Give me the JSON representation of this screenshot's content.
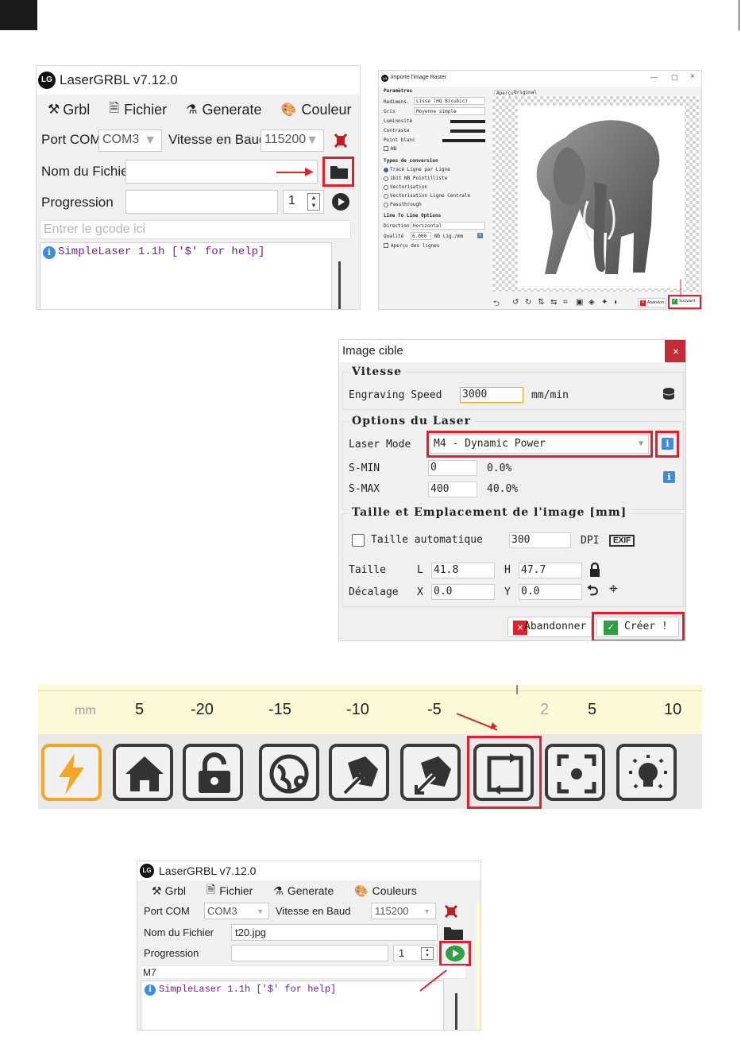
{
  "app": {
    "title": "LaserGRBL v7.12.0",
    "logo_text": "LG"
  },
  "menu": {
    "grbl": "Grbl",
    "fichier": "Fichier",
    "generate": "Generate",
    "couleurs_cut": "Couleur",
    "couleurs": "Couleurs"
  },
  "main1": {
    "port_label": "Port COM",
    "port_value": "COM3",
    "baud_label": "Vitesse en Baud",
    "baud_value": "115200",
    "file_label": "Nom du Fichier",
    "file_value": "",
    "progress_label": "Progression",
    "repeat_value": "1",
    "gcode_placeholder": "Entrer le gcode ici",
    "console_line": "SimpleLaser 1.1h ['$' for help]"
  },
  "raster": {
    "title": "Importe l'image Raster",
    "group_params": "Paramètres",
    "redim_label": "Redimens.",
    "redim_value": "Lisse (HQ Bicubic)",
    "gris_label": "Gris",
    "gris_value": "Moyenne simple",
    "lum_label": "Luminosité",
    "contrast_label": "Contraste",
    "white_label": "Point blanc",
    "nb_label": "NB",
    "group_conv": "Types de conversion",
    "conv_options": [
      "Tracé Ligne par Ligne",
      "1bit NB Pointilliste",
      "Vectorisation",
      "Vectorisation Ligne Centrale",
      "Passthrough"
    ],
    "group_line": "Line To Line Options",
    "direction_label": "Direction",
    "direction_value": "Horizontal",
    "quality_label": "Qualité",
    "quality_value": "6.000",
    "quality_unit": "Nb Lig./mm",
    "preview_lines_label": "Aperçu des lignes",
    "tab_preview": "Aperçu",
    "tab_original": "Original",
    "btn_cancel": "Abandon.",
    "btn_next": "Suivant"
  },
  "cible": {
    "title": "Image cible",
    "close": "×",
    "group_speed": "Vitesse",
    "speed_label": "Engraving Speed",
    "speed_value": "3000",
    "speed_unit": "mm/min",
    "group_laser": "Options du Laser",
    "mode_label": "Laser Mode",
    "mode_value": "M4 - Dynamic Power",
    "smin_label": "S-MIN",
    "smin_value": "0",
    "smin_pct": "0.0%",
    "smax_label": "S-MAX",
    "smax_value": "400",
    "smax_pct": "40.0%",
    "group_size": "Taille et Emplacement de l'image [mm]",
    "auto_label": "Taille automatique",
    "dpi_value": "300",
    "dpi_label": "DPI",
    "exif_label": "EXIF",
    "size_label": "Taille",
    "l_label": "L",
    "l_value": "41.8",
    "h_label": "H",
    "h_value": "47.7",
    "offset_label": "Décalage",
    "x_label": "X",
    "x_value": "0.0",
    "y_label": "Y",
    "y_value": "0.0",
    "btn_cancel": "Abandonner",
    "btn_create": "Créer !"
  },
  "ruler": {
    "unit": "mm",
    "ticks": [
      "5",
      "-20",
      "-15",
      "-10",
      "-5",
      "2",
      "5",
      "10"
    ]
  },
  "toolbar_icons": [
    "lightning-icon",
    "home-icon",
    "unlock-icon",
    "globe-pin-icon",
    "jog-northeast-icon",
    "jog-southwest-icon",
    "frame-icon",
    "focus-icon",
    "light-bulb-icon"
  ],
  "main2": {
    "port_label": "Port COM",
    "port_value": "COM3",
    "baud_label": "Vitesse en Baud",
    "baud_value": "115200",
    "file_label": "Nom du Fichier",
    "file_value": "t20.jpg",
    "progress_label": "Progression",
    "repeat_value": "1",
    "gcode_value": "M7",
    "console_line": "SimpleLaser 1.1h ['$' for help]"
  },
  "colors": {
    "highlight": "#e2202c",
    "accent_orange": "#f5a623",
    "info_blue": "#3a8de0",
    "run_green": "#2ea043"
  }
}
